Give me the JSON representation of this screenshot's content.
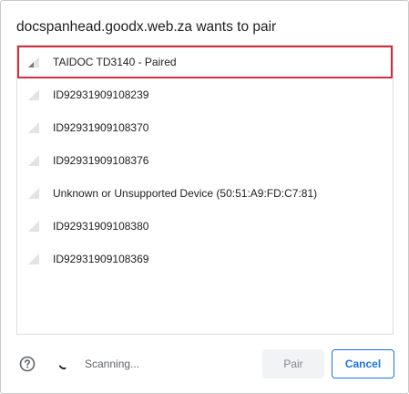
{
  "dialog": {
    "title": "docspanhead.goodx.web.za wants to pair"
  },
  "devices": [
    {
      "label": "TAIDOC TD3140 - Paired",
      "selected": true
    },
    {
      "label": "ID92931909108239",
      "selected": false
    },
    {
      "label": "ID92931909108370",
      "selected": false
    },
    {
      "label": "ID92931909108376",
      "selected": false
    },
    {
      "label": "Unknown or Unsupported Device (50:51:A9:FD:C7:81)",
      "selected": false
    },
    {
      "label": "ID92931909108380",
      "selected": false
    },
    {
      "label": "ID92931909108369",
      "selected": false
    }
  ],
  "footer": {
    "help_icon": "question-circle-icon",
    "status_text": "Scanning...",
    "pair_label": "Pair",
    "cancel_label": "Cancel"
  },
  "colors": {
    "selection_outline": "#d32f3a",
    "accent": "#1a73e8",
    "disabled_bg": "#f1f3f4"
  }
}
